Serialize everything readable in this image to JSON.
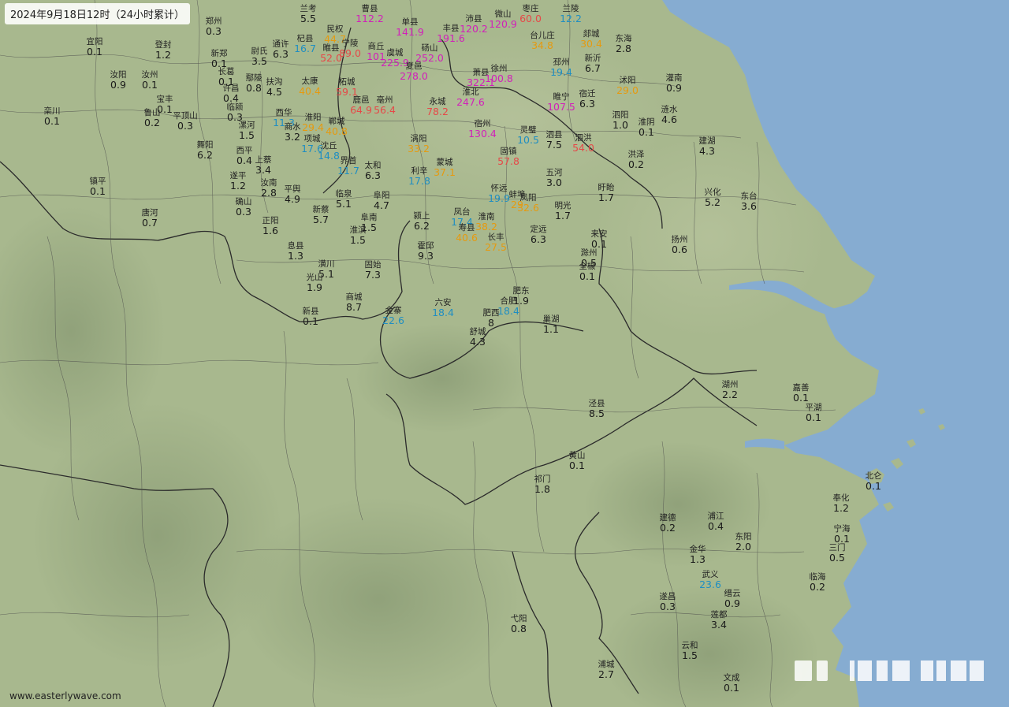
{
  "title": "2024年9月18日12时（24小时累计）",
  "credit": "www.easterlywave.com",
  "colors": {
    "land": "#a8b88e",
    "sea": "#86acd1",
    "border": "#333333",
    "tier_low": "#1a1a1a",
    "tier_10": "#1f8ec2",
    "tier_25": "#e59a10",
    "tier_50": "#e64848",
    "tier_100": "#d21fba"
  },
  "stations": [
    {
      "name": "兰考",
      "value": "5.5",
      "tier": "low"
    },
    {
      "name": "曹县",
      "value": "112.2",
      "tier": "t100"
    },
    {
      "name": "单县",
      "value": "141.9",
      "tier": "t100"
    },
    {
      "name": "丰县",
      "value": "191.6",
      "tier": "t100"
    },
    {
      "name": "沛县",
      "value": "120.2",
      "tier": "t100"
    },
    {
      "name": "微山",
      "value": "120.9",
      "tier": "t100"
    },
    {
      "name": "枣庄",
      "value": "60.0",
      "tier": "t50"
    },
    {
      "name": "兰陵",
      "value": "12.2",
      "tier": "t10"
    },
    {
      "name": "郑州",
      "value": "0.3",
      "tier": "low"
    },
    {
      "name": "宜阳",
      "value": "0.1",
      "tier": "low"
    },
    {
      "name": "登封",
      "value": "1.2",
      "tier": "low"
    },
    {
      "name": "新郑",
      "value": "0.1",
      "tier": "low"
    },
    {
      "name": "尉氏",
      "value": "3.5",
      "tier": "low"
    },
    {
      "name": "通许",
      "value": "6.3",
      "tier": "low"
    },
    {
      "name": "杞县",
      "value": "16.7",
      "tier": "t10"
    },
    {
      "name": "民权",
      "value": "44.7",
      "tier": "t25"
    },
    {
      "name": "睢县",
      "value": "52.0",
      "tier": "t50"
    },
    {
      "name": "宁陵",
      "value": "89.0",
      "tier": "t50"
    },
    {
      "name": "商丘",
      "value": "101",
      "tier": "t100"
    },
    {
      "name": "虞城",
      "value": "225.9",
      "tier": "t100"
    },
    {
      "name": "砀山",
      "value": "252.0",
      "tier": "t100"
    },
    {
      "name": "夏邑",
      "value": "278.0",
      "tier": "t100"
    },
    {
      "name": "台儿庄",
      "value": "34.8",
      "tier": "t25"
    },
    {
      "name": "郯城",
      "value": "30.4",
      "tier": "t25"
    },
    {
      "name": "东海",
      "value": "2.8",
      "tier": "low"
    },
    {
      "name": "汝阳",
      "value": "0.9",
      "tier": "low"
    },
    {
      "name": "汝州",
      "value": "0.1",
      "tier": "low"
    },
    {
      "name": "长葛",
      "value": "0.1",
      "tier": "low"
    },
    {
      "name": "鄢陵",
      "value": "0.8",
      "tier": "low"
    },
    {
      "name": "扶沟",
      "value": "4.5",
      "tier": "low"
    },
    {
      "name": "太康",
      "value": "40.4",
      "tier": "t25"
    },
    {
      "name": "柘城",
      "value": "59.1",
      "tier": "t50"
    },
    {
      "name": "萧县",
      "value": "322.1",
      "tier": "t100"
    },
    {
      "name": "徐州",
      "value": "100.8",
      "tier": "t100"
    },
    {
      "name": "邳州",
      "value": "19.4",
      "tier": "t10"
    },
    {
      "name": "新沂",
      "value": "6.7",
      "tier": "low"
    },
    {
      "name": "灌南",
      "value": "0.9",
      "tier": "low"
    },
    {
      "name": "许昌",
      "value": "0.4",
      "tier": "low"
    },
    {
      "name": "宝丰",
      "value": "0.1",
      "tier": "low"
    },
    {
      "name": "鲁山",
      "value": "0.2",
      "tier": "low"
    },
    {
      "name": "平顶山",
      "value": "0.3",
      "tier": "low"
    },
    {
      "name": "临颍",
      "value": "0.3",
      "tier": "low"
    },
    {
      "name": "西华",
      "value": "11.3",
      "tier": "t10"
    },
    {
      "name": "淮阳",
      "value": "29.4",
      "tier": "t25"
    },
    {
      "name": "郸城",
      "value": "40.8",
      "tier": "t25"
    },
    {
      "name": "鹿邑",
      "value": "64.9",
      "tier": "t50"
    },
    {
      "name": "亳州",
      "value": "56.4",
      "tier": "t50"
    },
    {
      "name": "永城",
      "value": "78.2",
      "tier": "t50"
    },
    {
      "name": "淮北",
      "value": "247.6",
      "tier": "t100"
    },
    {
      "name": "睢宁",
      "value": "107.5",
      "tier": "t100"
    },
    {
      "name": "宿迁",
      "value": "6.3",
      "tier": "low"
    },
    {
      "name": "沭阳",
      "value": "29.0",
      "tier": "t25"
    },
    {
      "name": "涟水",
      "value": "4.6",
      "tier": "low"
    },
    {
      "name": "栾川",
      "value": "0.1",
      "tier": "low"
    },
    {
      "name": "漯河",
      "value": "1.5",
      "tier": "low"
    },
    {
      "name": "商水",
      "value": "3.2",
      "tier": "low"
    },
    {
      "name": "项城",
      "value": "17.6",
      "tier": "t10"
    },
    {
      "name": "沈丘",
      "value": "14.8",
      "tier": "t10"
    },
    {
      "name": "宿州",
      "value": "130.4",
      "tier": "t100"
    },
    {
      "name": "灵璧",
      "value": "10.5",
      "tier": "t10"
    },
    {
      "name": "泗县",
      "value": "7.5",
      "tier": "low"
    },
    {
      "name": "泗洪",
      "value": "54.0",
      "tier": "t50"
    },
    {
      "name": "泗阳",
      "value": "1.0",
      "tier": "low"
    },
    {
      "name": "淮阴",
      "value": "0.1",
      "tier": "low"
    },
    {
      "name": "舞阳",
      "value": "6.2",
      "tier": "low"
    },
    {
      "name": "西平",
      "value": "0.4",
      "tier": "low"
    },
    {
      "name": "上蔡",
      "value": "3.4",
      "tier": "low"
    },
    {
      "name": "涡阳",
      "value": "33.2",
      "tier": "t25"
    },
    {
      "name": "蒙城",
      "value": "37.1",
      "tier": "t25"
    },
    {
      "name": "固镇",
      "value": "57.8",
      "tier": "t50"
    },
    {
      "name": "建湖",
      "value": "4.3",
      "tier": "low"
    },
    {
      "name": "洪泽",
      "value": "0.2",
      "tier": "low"
    },
    {
      "name": "界首",
      "value": "11.7",
      "tier": "t10"
    },
    {
      "name": "太和",
      "value": "6.3",
      "tier": "low"
    },
    {
      "name": "利辛",
      "value": "17.8",
      "tier": "t10"
    },
    {
      "name": "五河",
      "value": "3.0",
      "tier": "low"
    },
    {
      "name": "镇平",
      "value": "0.1",
      "tier": "low"
    },
    {
      "name": "遂平",
      "value": "1.2",
      "tier": "low"
    },
    {
      "name": "汝南",
      "value": "2.8",
      "tier": "low"
    },
    {
      "name": "平舆",
      "value": "4.9",
      "tier": "low"
    },
    {
      "name": "确山",
      "value": "0.3",
      "tier": "low"
    },
    {
      "name": "怀远",
      "value": "19.9",
      "tier": "t10"
    },
    {
      "name": "蚌埠",
      "value": "29",
      "tier": "t25"
    },
    {
      "name": "凤阳",
      "value": "32.6",
      "tier": "t25"
    },
    {
      "name": "盱眙",
      "value": "1.7",
      "tier": "low"
    },
    {
      "name": "兴化",
      "value": "5.2",
      "tier": "low"
    },
    {
      "name": "东台",
      "value": "3.6",
      "tier": "low"
    },
    {
      "name": "临泉",
      "value": "5.1",
      "tier": "low"
    },
    {
      "name": "阜阳",
      "value": "4.7",
      "tier": "low"
    },
    {
      "name": "唐河",
      "value": "0.7",
      "tier": "low"
    },
    {
      "name": "新蔡",
      "value": "5.7",
      "tier": "low"
    },
    {
      "name": "正阳",
      "value": "1.6",
      "tier": "low"
    },
    {
      "name": "阜南",
      "value": "1.5",
      "tier": "low"
    },
    {
      "name": "颍上",
      "value": "6.2",
      "tier": "low"
    },
    {
      "name": "凤台",
      "value": "17.4",
      "tier": "t10"
    },
    {
      "name": "淮南",
      "value": "38.2",
      "tier": "t25"
    },
    {
      "name": "寿县",
      "value": "40.6",
      "tier": "t25"
    },
    {
      "name": "明光",
      "value": "1.7",
      "tier": "low"
    },
    {
      "name": "定远",
      "value": "6.3",
      "tier": "low"
    },
    {
      "name": "来安",
      "value": "0.1",
      "tier": "low"
    },
    {
      "name": "扬州",
      "value": "0.6",
      "tier": "low"
    },
    {
      "name": "息县",
      "value": "1.3",
      "tier": "low"
    },
    {
      "name": "淮滨",
      "value": "1.5",
      "tier": "low"
    },
    {
      "name": "霍邱",
      "value": "9.3",
      "tier": "low"
    },
    {
      "name": "长丰",
      "value": "27.5",
      "tier": "t25"
    },
    {
      "name": "滁州",
      "value": "0.5",
      "tier": "low"
    },
    {
      "name": "全椒",
      "value": "0.1",
      "tier": "low"
    },
    {
      "name": "潢川",
      "value": "5.1",
      "tier": "low"
    },
    {
      "name": "固始",
      "value": "7.3",
      "tier": "low"
    },
    {
      "name": "光山",
      "value": "1.9",
      "tier": "low"
    },
    {
      "name": "肥东",
      "value": "1.9",
      "tier": "low"
    },
    {
      "name": "合肥",
      "value": "18.4",
      "tier": "t10"
    },
    {
      "name": "六安",
      "value": "18.4",
      "tier": "t10"
    },
    {
      "name": "商城",
      "value": "8.7",
      "tier": "low"
    },
    {
      "name": "金寨",
      "value": "22.6",
      "tier": "t10"
    },
    {
      "name": "新县",
      "value": "0.1",
      "tier": "low"
    },
    {
      "name": "肥西",
      "value": "8",
      "tier": "low"
    },
    {
      "name": "舒城",
      "value": "4.3",
      "tier": "low"
    },
    {
      "name": "巢湖",
      "value": "1.1",
      "tier": "low"
    },
    {
      "name": "湖州",
      "value": "2.2",
      "tier": "low"
    },
    {
      "name": "嘉善",
      "value": "0.1",
      "tier": "low"
    },
    {
      "name": "平湖",
      "value": "0.1",
      "tier": "low"
    },
    {
      "name": "泾县",
      "value": "8.5",
      "tier": "low"
    },
    {
      "name": "黄山",
      "value": "0.1",
      "tier": "low"
    },
    {
      "name": "祁门",
      "value": "1.8",
      "tier": "low"
    },
    {
      "name": "北仑",
      "value": "0.1",
      "tier": "low"
    },
    {
      "name": "奉化",
      "value": "1.2",
      "tier": "low"
    },
    {
      "name": "建德",
      "value": "0.2",
      "tier": "low"
    },
    {
      "name": "浦江",
      "value": "0.4",
      "tier": "low"
    },
    {
      "name": "东阳",
      "value": "2.0",
      "tier": "low"
    },
    {
      "name": "金华",
      "value": "1.3",
      "tier": "low"
    },
    {
      "name": "宁海",
      "value": "0.1",
      "tier": "low"
    },
    {
      "name": "三门",
      "value": "0.5",
      "tier": "low"
    },
    {
      "name": "武义",
      "value": "23.6",
      "tier": "t10"
    },
    {
      "name": "临海",
      "value": "0.2",
      "tier": "low"
    },
    {
      "name": "缙云",
      "value": "0.9",
      "tier": "low"
    },
    {
      "name": "遂昌",
      "value": "0.3",
      "tier": "low"
    },
    {
      "name": "莲都",
      "value": "3.4",
      "tier": "low"
    },
    {
      "name": "弋阳",
      "value": "0.8",
      "tier": "low"
    },
    {
      "name": "云和",
      "value": "1.5",
      "tier": "low"
    },
    {
      "name": "浦城",
      "value": "2.7",
      "tier": "low"
    },
    {
      "name": "文成",
      "value": "0.1",
      "tier": "low"
    }
  ]
}
